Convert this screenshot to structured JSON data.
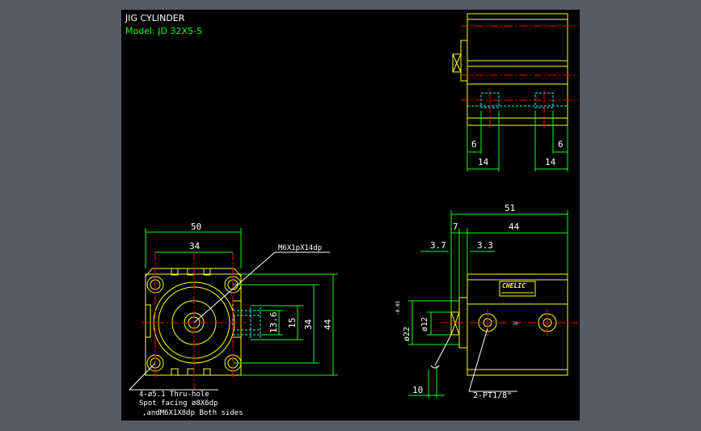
{
  "title": "JIG CYLINDER",
  "model": "Model: JD 32X5-S",
  "colors": {
    "background": "#000000",
    "frame": "#585b66",
    "outline": "#ffff00",
    "dimension": "#00ff00",
    "centerline": "#ff0000",
    "hidden": "#00ffff",
    "text": "#ffffff",
    "leader": "#ffffff"
  },
  "front_view": {
    "dims": {
      "width_outer": "50",
      "width_inner": "34",
      "height_outer": "44",
      "height_inner": "34",
      "port_15": "15",
      "port_13_6": "13.6"
    },
    "thread_callout": "M6X1pX14dp",
    "notes": [
      "4-ø5.1 Thru-hole",
      "Spot facing ø8X6dp",
      ",andM6X1X8dp Both sides"
    ]
  },
  "top_view": {
    "dims": {
      "left_6": "6",
      "left_14": "14",
      "right_6": "6",
      "right_14": "14"
    }
  },
  "side_view": {
    "dims": {
      "overall": "51",
      "body": "44",
      "rod": "7",
      "d3_7": "3.7",
      "d3_3": "3.3",
      "d10": "10",
      "bore": "ø22",
      "tolerance": "-0.05",
      "rod_dia": "ø12"
    },
    "brand": "CHELIC",
    "port_callout": "2-PT1/8\""
  }
}
